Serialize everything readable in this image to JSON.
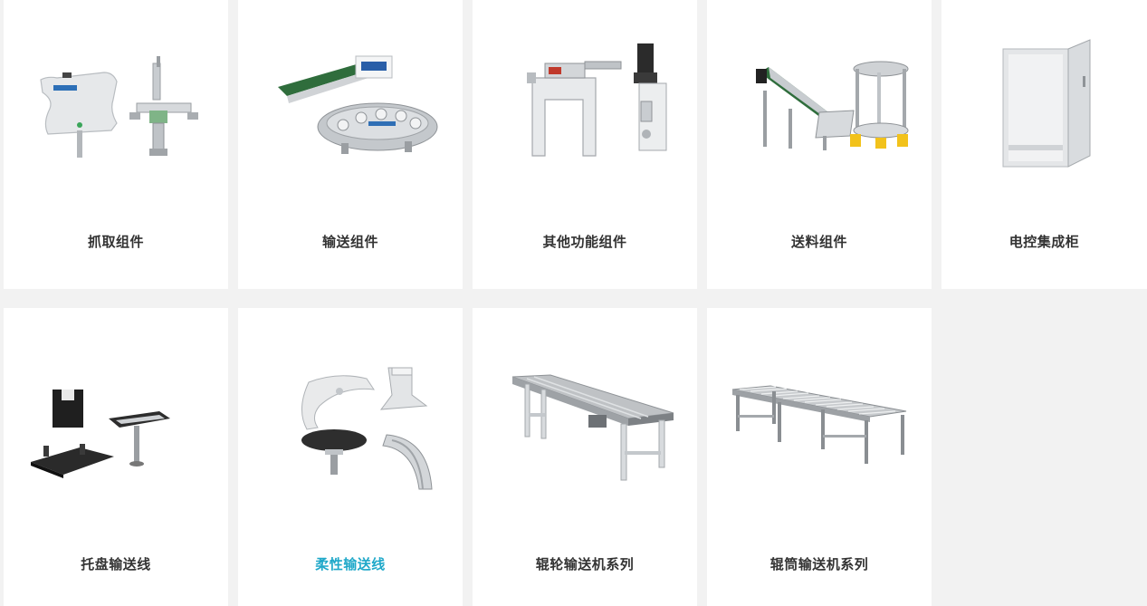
{
  "products": [
    {
      "label": "抓取组件",
      "icon": "gripper-assembly-image",
      "active": false
    },
    {
      "label": "输送组件",
      "icon": "conveyor-assembly-image",
      "active": false
    },
    {
      "label": "其他功能组件",
      "icon": "function-module-image",
      "active": false
    },
    {
      "label": "送料组件",
      "icon": "feeder-assembly-image",
      "active": false
    },
    {
      "label": "电控集成柜",
      "icon": "control-cabinet-image",
      "active": false
    },
    {
      "label": "托盘输送线",
      "icon": "pallet-conveyor-image",
      "active": false
    },
    {
      "label": "柔性输送线",
      "icon": "flexible-conveyor-image",
      "active": true
    },
    {
      "label": "辊轮输送机系列",
      "icon": "wheel-roller-conveyor-image",
      "active": false
    },
    {
      "label": "辊筒输送机系列",
      "icon": "drum-roller-conveyor-image",
      "active": false
    }
  ],
  "colors": {
    "page_bg": "#f2f2f2",
    "card_bg": "#ffffff",
    "label_text": "#333333",
    "active_label": "#1fa8c9"
  }
}
